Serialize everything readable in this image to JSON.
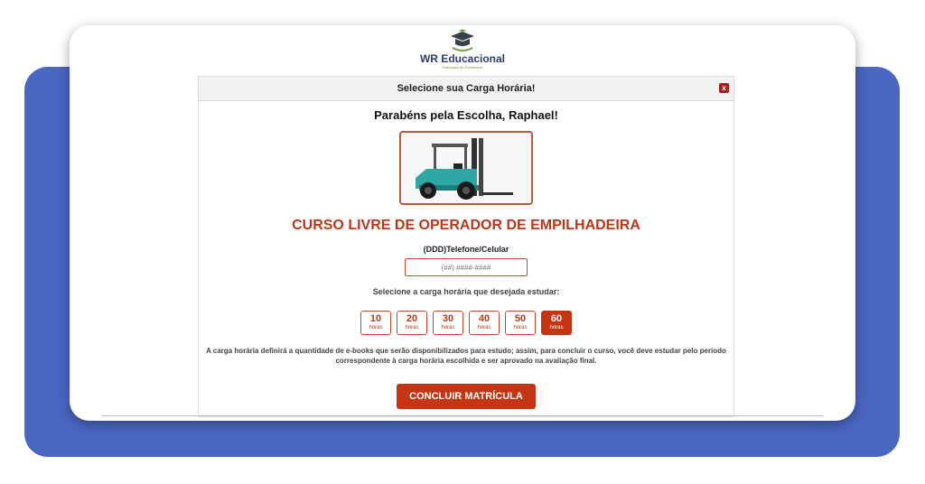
{
  "logo": {
    "title": "WR Educacional",
    "subtitle": "Educação de Excelência",
    "icon": "graduation-cap-icon"
  },
  "modal": {
    "header": "Selecione sua Carga Horária!",
    "close_label": "x",
    "greeting": "Parabéns pela Escolha, Raphael!",
    "product_image": "forklift-image",
    "course_title": "CURSO LIVRE DE OPERADOR DE EMPILHADEIRA",
    "phone": {
      "label": "(DDD)Telefone/Celular",
      "placeholder": "(##) ####-####",
      "value": ""
    },
    "hours_label": "Selecione a carga horária que desejada estudar:",
    "hours": [
      {
        "value": "10",
        "unit": "horas",
        "selected": false
      },
      {
        "value": "20",
        "unit": "horas",
        "selected": false
      },
      {
        "value": "30",
        "unit": "horas",
        "selected": false
      },
      {
        "value": "40",
        "unit": "horas",
        "selected": false
      },
      {
        "value": "50",
        "unit": "horas",
        "selected": false
      },
      {
        "value": "60",
        "unit": "horas",
        "selected": true
      }
    ],
    "note": "A carga horária definirá a quantidade de e-books que serão disponibilizados para estudo; assim, para concluir o curso, você deve estudar pelo período correspondente à carga horária escolhida e ser aprovado na avaliação final.",
    "submit_label": "CONCLUIR MATRÍCULA"
  },
  "colors": {
    "accent": "#c43613",
    "background_panel": "#4a67c3",
    "title_red": "#b8391a"
  }
}
